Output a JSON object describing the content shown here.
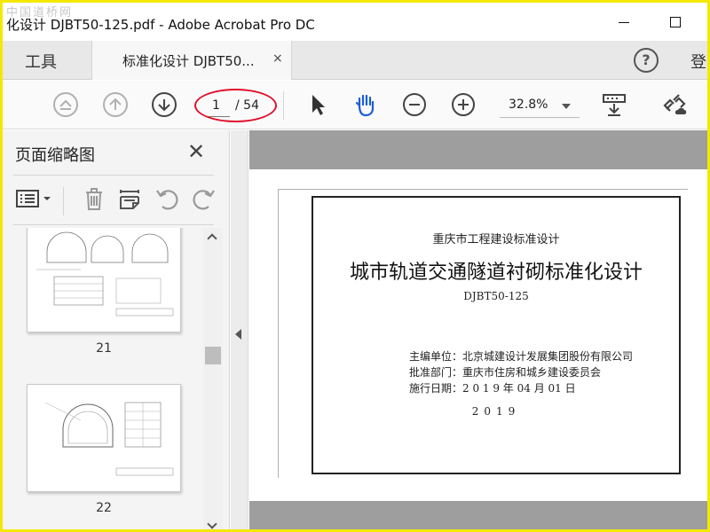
{
  "window": {
    "title": "化设计 DJBT50-125.pdf - Adobe Acrobat Pro DC",
    "watermark": "中国道桥网"
  },
  "tabs": {
    "tools_label": "工具",
    "document_label": "标准化设计 DJBT50...",
    "close_symbol": "×",
    "help_symbol": "?",
    "signin_label": "登"
  },
  "toolbar": {
    "current_page": "1",
    "total_pages": "/ 54",
    "zoom": "32.8%",
    "highlight_color": "#e0102a"
  },
  "panel": {
    "title": "页面缩略图",
    "close_symbol": "✕",
    "thumbnails": [
      {
        "label": "21"
      },
      {
        "label": "22"
      }
    ]
  },
  "document": {
    "org": "重庆市工程建设标准设计",
    "main_title": "城市轨道交通隧道衬砌标准化设计",
    "code": "DJBT50-125",
    "editor": "主编单位：北京城建设计发展集团股份有限公司",
    "approver": "批准部门：重庆市住房和城乡建设委员会",
    "date": "施行日期：2 0 1 9 年 04 月 01 日",
    "year": "2019"
  },
  "colors": {
    "frame": "#f5e800",
    "hand_tool": "#1a5fd6"
  }
}
